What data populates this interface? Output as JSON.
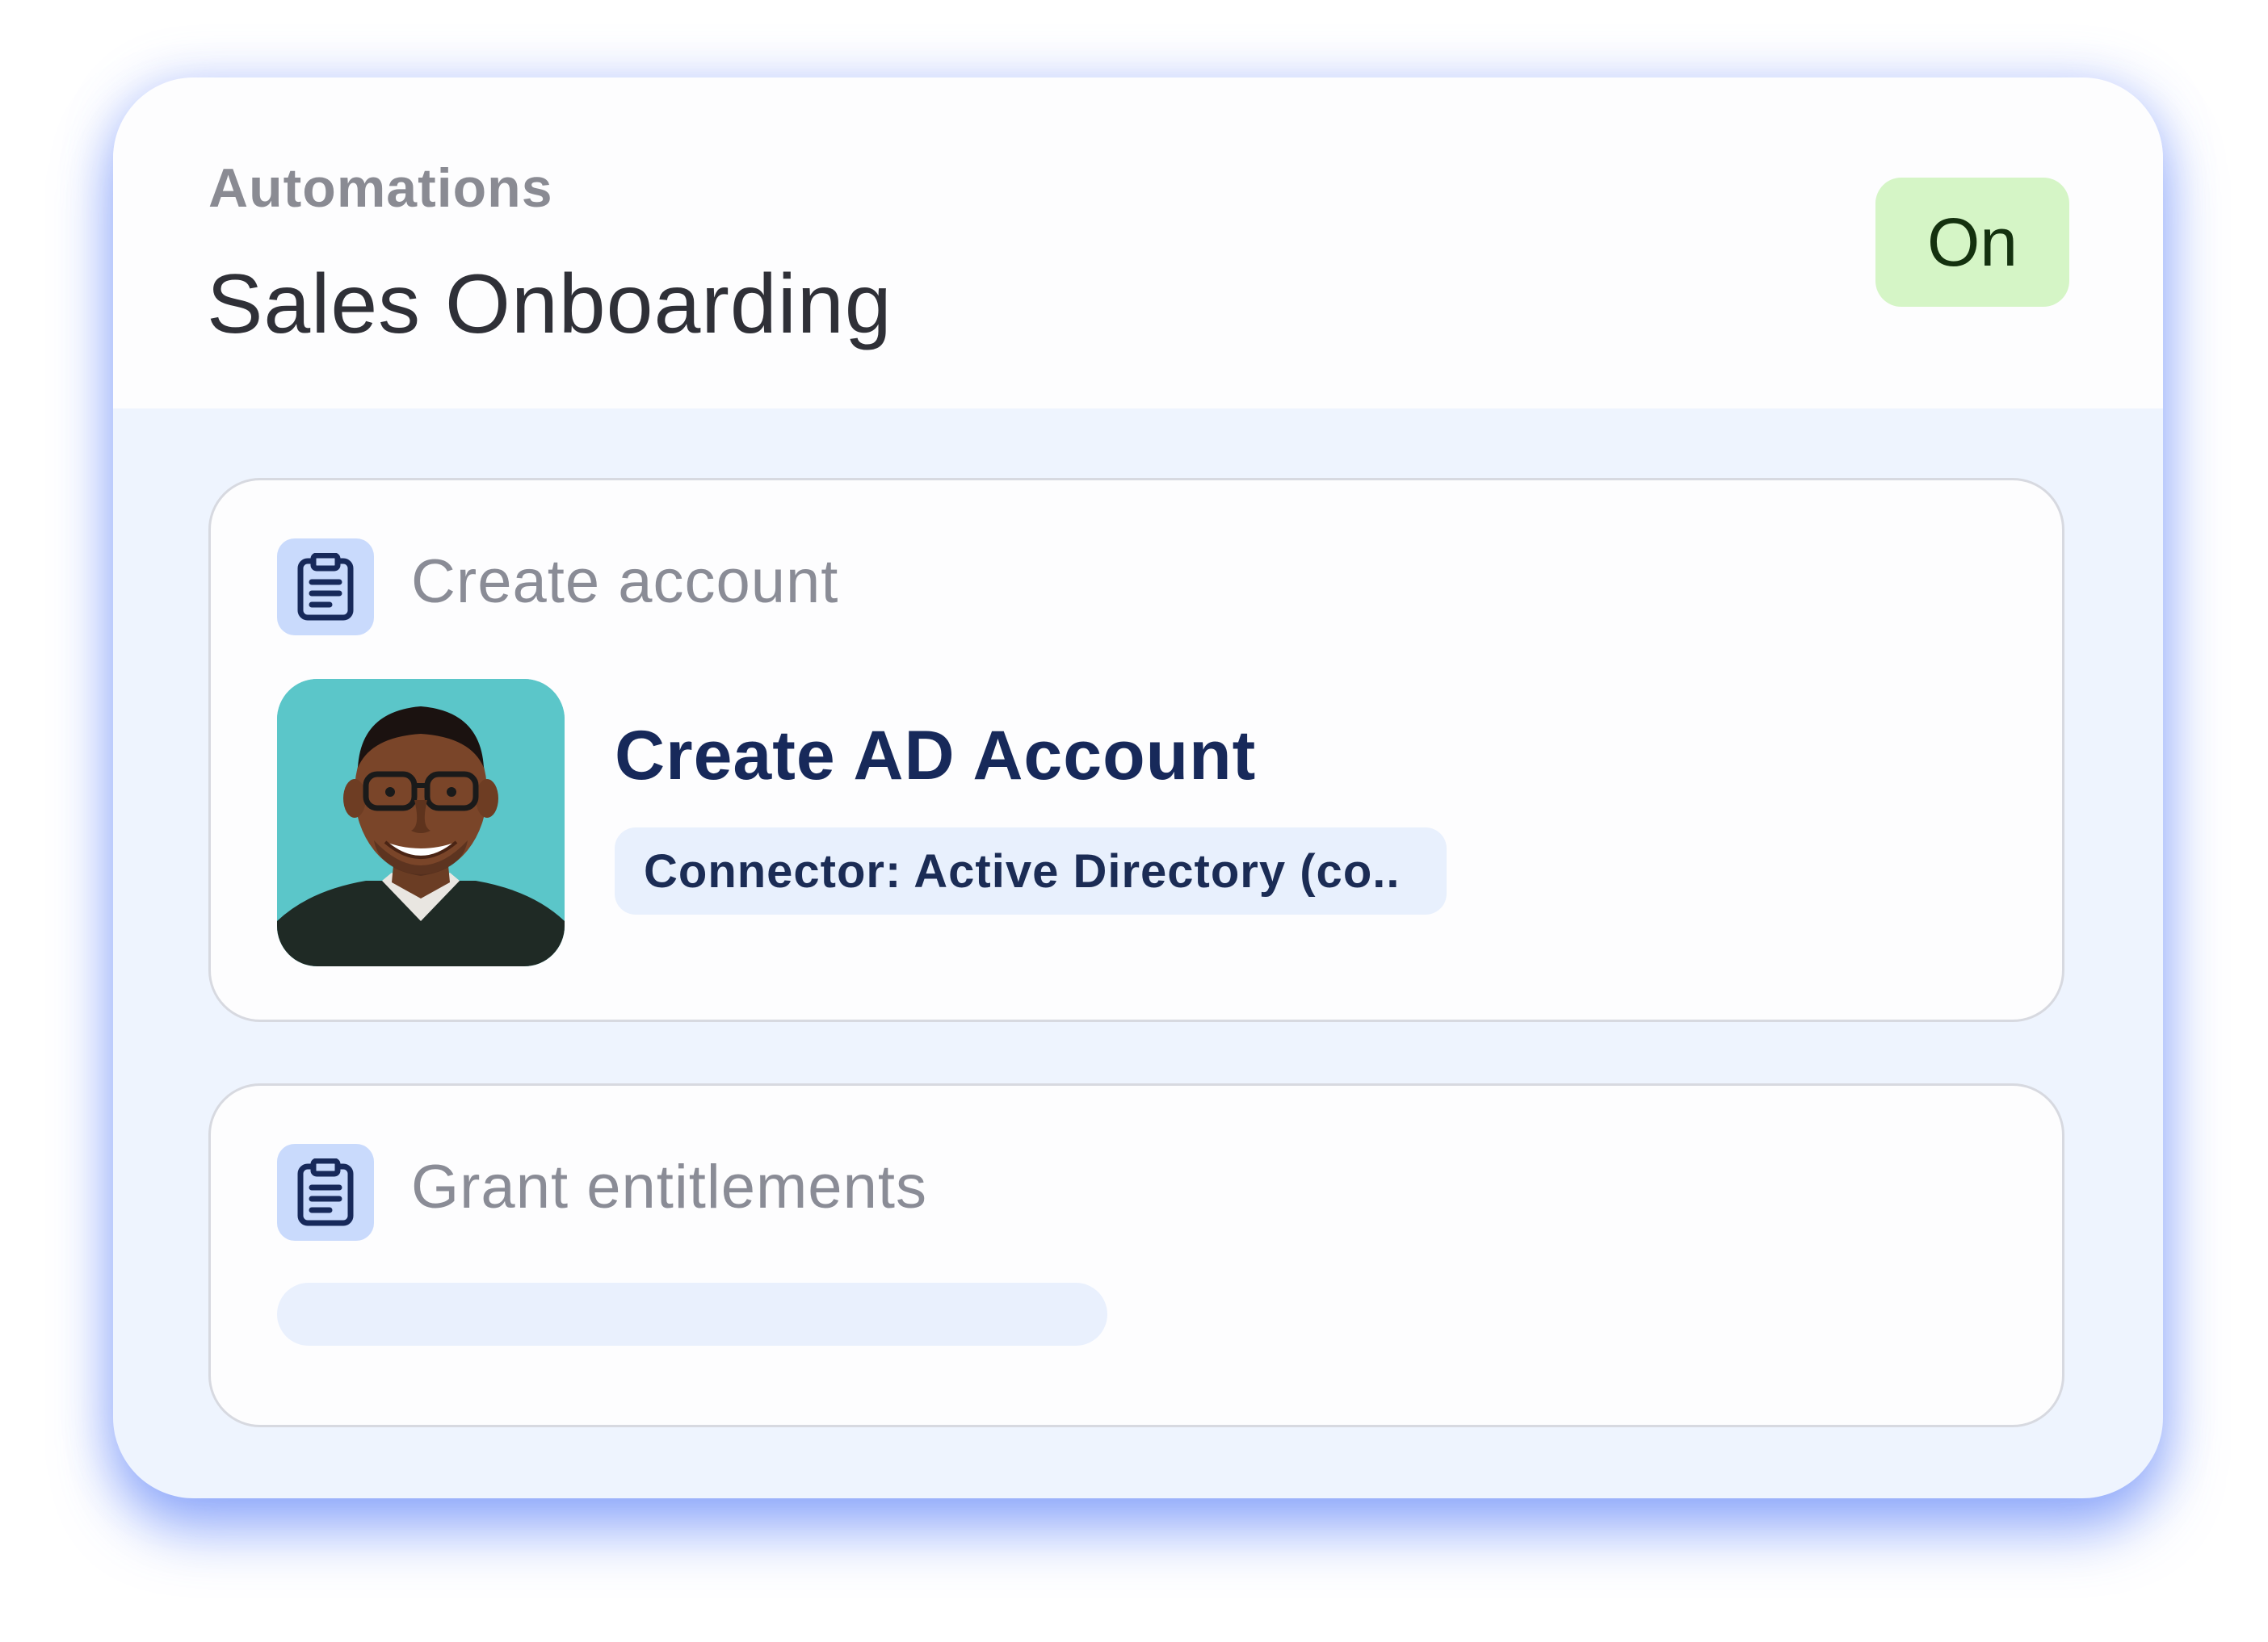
{
  "header": {
    "eyebrow": "Automations",
    "title": "Sales Onboarding",
    "status": "On"
  },
  "steps": [
    {
      "label": "Create account",
      "icon": "clipboard-icon",
      "task": {
        "title": "Create AD Account",
        "connector": "Connector: Active Directory (co.."
      }
    },
    {
      "label": "Grant entitlements",
      "icon": "clipboard-icon"
    }
  ],
  "colors": {
    "status_bg": "#d5f5c6",
    "status_text": "#14310f",
    "accent_shadow": "#4873f8",
    "task_title": "#17295a",
    "icon_bg": "#c9dafc",
    "avatar_bg": "#5bc6c9"
  }
}
